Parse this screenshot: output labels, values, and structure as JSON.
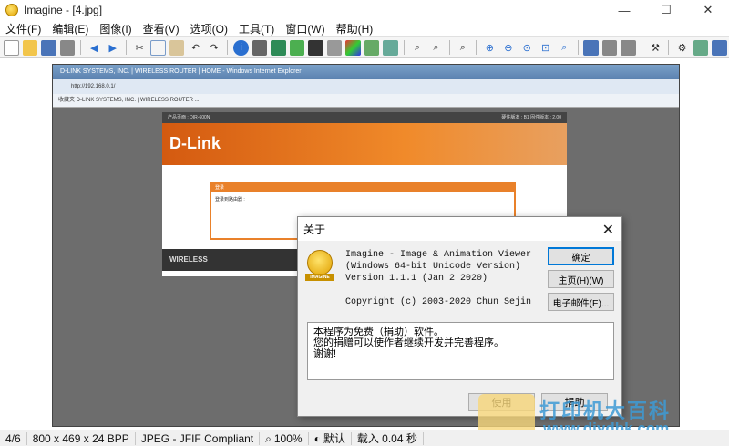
{
  "window": {
    "title": "Imagine - [4.jpg]",
    "minimize": "—",
    "maximize": "☐",
    "close": "✕"
  },
  "menu": [
    "文件(F)",
    "编辑(E)",
    "图像(I)",
    "查看(V)",
    "选项(O)",
    "工具(T)",
    "窗口(W)",
    "帮助(H)"
  ],
  "toolbar": {
    "icons": [
      "new-icon",
      "open-icon",
      "save-icon",
      "print-icon",
      "prev-icon",
      "next-icon",
      "cut-icon",
      "copy-icon",
      "paste-icon",
      "undo-icon",
      "redo-icon",
      "info-icon",
      "screenshot-icon",
      "image-icon",
      "effects-icon",
      "palette-icon",
      "tool-icon",
      "zoom-icon",
      "settings-icon"
    ]
  },
  "photo": {
    "ie_title": "D-LINK SYSTEMS, INC. | WIRELESS ROUTER | HOME - Windows Internet Explorer",
    "ie_address": "http://192.168.0.1/",
    "ie_fav": "收藏夹   D-LINK SYSTEMS, INC. | WIRELESS ROUTER ...",
    "router_top": "产品页面 : DIR-600N",
    "router_top_right": "硬件版本 : B1   固件版本 : 2.00",
    "brand": "D-Link",
    "login_title": "登录",
    "login_sub": "登录到路由器 :",
    "footer": "WIRELESS"
  },
  "dialog": {
    "title": "关于",
    "close": "✕",
    "logo_label": "IMAGINE",
    "line1": "Imagine - Image & Animation Viewer",
    "line2": "(Windows 64-bit Unicode Version)",
    "line3": "Version 1.1.1 (Jan  2 2020)",
    "line4": "Copyright (c) 2003-2020 Chun Sejin",
    "btn_ok": "确定",
    "btn_home": "主页(H)(W)",
    "btn_email": "电子邮件(E)...",
    "text1": "本程序为免费（捐助）软件。",
    "text2": "您的捐赠可以使作者继续开发并完善程序。",
    "text3": "谢谢!",
    "btn_bottom1": "使用",
    "btn_bottom2": "捐助"
  },
  "status": {
    "index": "4/6",
    "dimensions": "800 x 469 x 24 BPP",
    "format": "JPEG - JFIF Compliant",
    "zoom": "100%",
    "mode": "默认",
    "load": "载入 0.04 秒"
  },
  "watermark": {
    "text": "打印机大百科",
    "url": "www.djydbk.com"
  }
}
